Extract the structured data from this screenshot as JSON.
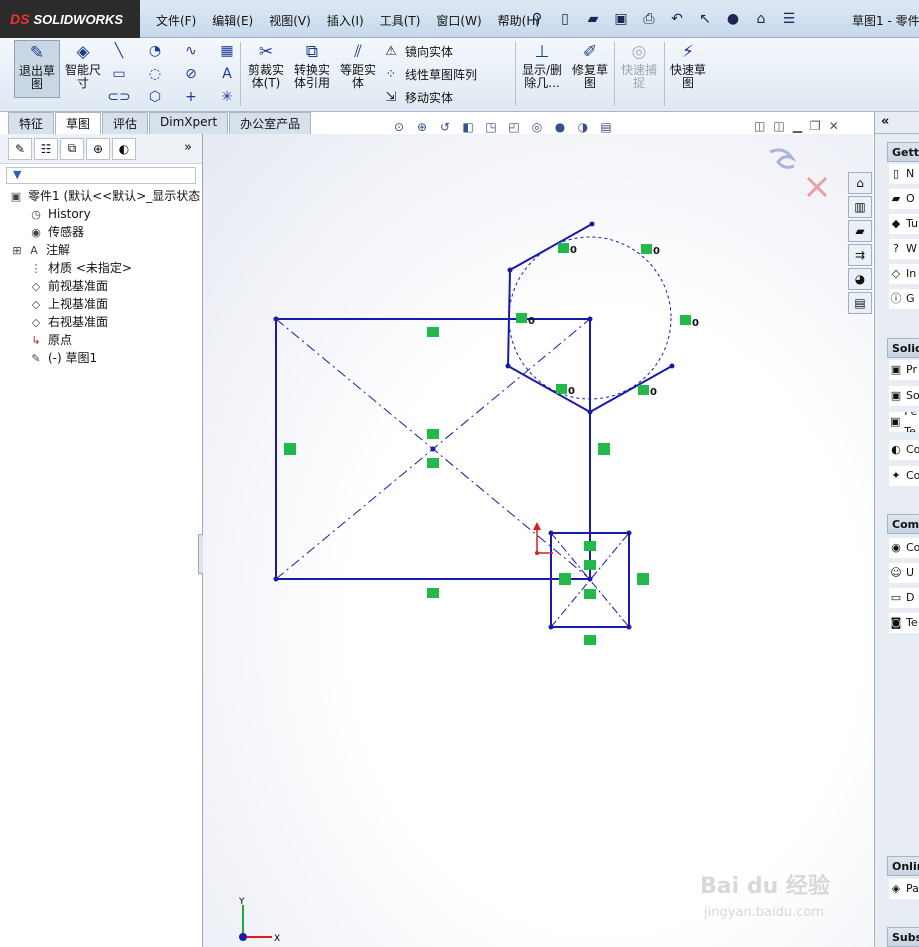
{
  "app": {
    "logo_text": "SOLIDWORKS",
    "logo_mark": "DS",
    "document_title": "草图1 - 零件"
  },
  "menu": [
    "文件(F)",
    "编辑(E)",
    "视图(V)",
    "插入(I)",
    "工具(T)",
    "窗口(W)",
    "帮助(H)"
  ],
  "command_manager": {
    "exit_sketch": "退出草图",
    "smart_dimension": "智能尺寸",
    "trim": "剪裁实体(T)",
    "convert": "转换实体引用",
    "offset": "等距实体",
    "mirror": "镜向实体",
    "linear_pattern": "线性草图阵列",
    "move": "移动实体",
    "display_delete": "显示/删除几...",
    "repair": "修复草图",
    "quick_snap": "快速捕捉",
    "rapid_sketch": "快速草图"
  },
  "tabs": [
    {
      "label": "特征"
    },
    {
      "label": "草图"
    },
    {
      "label": "评估"
    },
    {
      "label": "DimXpert"
    },
    {
      "label": "办公室产品"
    }
  ],
  "active_tab": "草图",
  "feature_tree": {
    "root": "零件1 (默认<<默认>_显示状态",
    "items": [
      "History",
      "传感器",
      "注解",
      "材质 <未指定>",
      "前视基准面",
      "上视基准面",
      "右视基准面",
      "原点",
      "(-) 草图1"
    ]
  },
  "relation_labels": [
    "0",
    "0",
    "0",
    "0",
    "0",
    "0"
  ],
  "triad": {
    "x": "X",
    "y": "Y"
  },
  "taskpane": {
    "sections": [
      "Getting",
      "SolidW",
      "Comm",
      "Online",
      "Subsc"
    ],
    "getting_items": [
      "N",
      "O",
      "Tu",
      "W",
      "In",
      "G"
    ],
    "solidw_items": [
      "Pr",
      "So",
      "Pe Te",
      "Co",
      "Co"
    ],
    "comm_items": [
      "Co",
      "U",
      "D",
      "Te"
    ],
    "online_items": [
      "Pa"
    ]
  },
  "watermark": {
    "brand": "Bai du 经验",
    "sub": "jingyan.baidu.com"
  },
  "colors": {
    "sketch": "#1a1aa8",
    "relation_green": "#22b84a",
    "origin_red": "#d42020"
  }
}
